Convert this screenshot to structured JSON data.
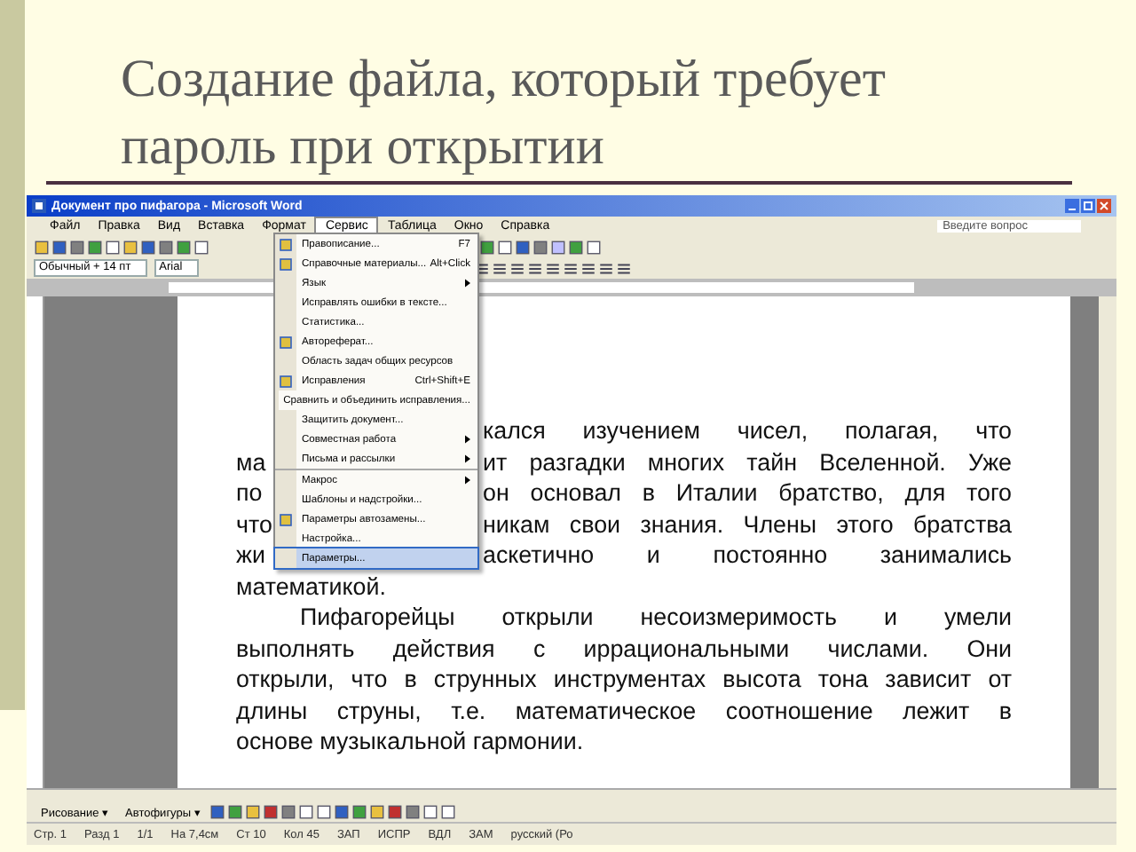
{
  "slide_title": "Создание файла, который требует пароль при открытии",
  "window": {
    "title": "Документ про пифагора - Microsoft Word"
  },
  "menu_bar": [
    {
      "label": "Файл",
      "selected": false
    },
    {
      "label": "Правка",
      "selected": false
    },
    {
      "label": "Вид",
      "selected": false
    },
    {
      "label": "Вставка",
      "selected": false
    },
    {
      "label": "Формат",
      "selected": false
    },
    {
      "label": "Сервис",
      "selected": true
    },
    {
      "label": "Таблица",
      "selected": false
    },
    {
      "label": "Окно",
      "selected": false
    },
    {
      "label": "Справка",
      "selected": false
    }
  ],
  "help_box": {
    "placeholder": "Введите вопрос"
  },
  "formatting": {
    "style": "Обычный + 14 пт",
    "font": "Arial"
  },
  "menu": [
    {
      "label": "Правописание...",
      "shortcut": "F7",
      "submenu": false,
      "has_icon": true,
      "selected": false,
      "separator_before": false
    },
    {
      "label": "Справочные материалы...",
      "shortcut": "Alt+Click",
      "submenu": false,
      "has_icon": true,
      "selected": false,
      "separator_before": false
    },
    {
      "label": "Язык",
      "submenu": true,
      "has_icon": false,
      "selected": false,
      "separator_before": false
    },
    {
      "label": "Исправлять ошибки в тексте...",
      "submenu": false,
      "has_icon": false,
      "selected": false,
      "separator_before": false
    },
    {
      "label": "Статистика...",
      "submenu": false,
      "has_icon": false,
      "selected": false,
      "separator_before": false
    },
    {
      "label": "Автореферат...",
      "submenu": false,
      "has_icon": true,
      "selected": false,
      "separator_before": false
    },
    {
      "label": "Область задач общих ресурсов",
      "submenu": false,
      "has_icon": false,
      "selected": false,
      "separator_before": false
    },
    {
      "label": "Исправления",
      "shortcut": "Ctrl+Shift+E",
      "submenu": false,
      "has_icon": true,
      "selected": false,
      "separator_before": false
    },
    {
      "label": "Сравнить и объединить исправления...",
      "submenu": false,
      "has_icon": false,
      "selected": false,
      "separator_before": false
    },
    {
      "label": "Защитить документ...",
      "submenu": false,
      "has_icon": false,
      "selected": false,
      "separator_before": false
    },
    {
      "label": "Совместная работа",
      "submenu": true,
      "has_icon": false,
      "selected": false,
      "separator_before": false
    },
    {
      "label": "Письма и рассылки",
      "submenu": true,
      "has_icon": false,
      "selected": false,
      "separator_before": false
    },
    {
      "label": "Макрос",
      "submenu": true,
      "has_icon": false,
      "selected": false,
      "separator_before": true
    },
    {
      "label": "Шаблоны и надстройки...",
      "submenu": false,
      "has_icon": false,
      "selected": false,
      "separator_before": false
    },
    {
      "label": "Параметры автозамены...",
      "submenu": false,
      "has_icon": true,
      "selected": false,
      "separator_before": false
    },
    {
      "label": "Настройка...",
      "submenu": false,
      "has_icon": false,
      "selected": false,
      "separator_before": false
    },
    {
      "label": "Параметры...",
      "submenu": false,
      "has_icon": false,
      "selected": true,
      "separator_before": false
    }
  ],
  "document": {
    "partial_lines": [
      {
        "right": "кался изучением чисел, полагая, что"
      },
      {
        "left": "ма",
        "right": "ит разгадки многих тайн Вселенной. Уже"
      },
      {
        "left": "по",
        "right": "он основал в Италии братство, для того"
      },
      {
        "left": "что",
        "right": "никам свои знания. Члены этого братства"
      },
      {
        "left": "жи",
        "right": "аскетично и постоянно занимались"
      }
    ],
    "line_end": "математикой.",
    "paragraph_lines": [
      "Пифагорейцы открыли несоизмеримость и умели",
      "выполнять действия с иррациональными числами. Они",
      "открыли, что в струнных инструментах высота тона зависит от",
      "длины струны, т.е. математическое соотношение лежит в",
      "основе музыкальной гармонии."
    ]
  },
  "drawing_toolbar": [
    "Рисование ▾",
    "Автофигуры ▾"
  ],
  "status_bar": [
    "Стр. 1",
    "Разд 1",
    "1/1",
    "На 7,4см",
    "Ст 10",
    "Кол 45",
    "ЗАП",
    "ИСПР",
    "ВДЛ",
    "ЗАМ",
    "русский (Ро"
  ]
}
